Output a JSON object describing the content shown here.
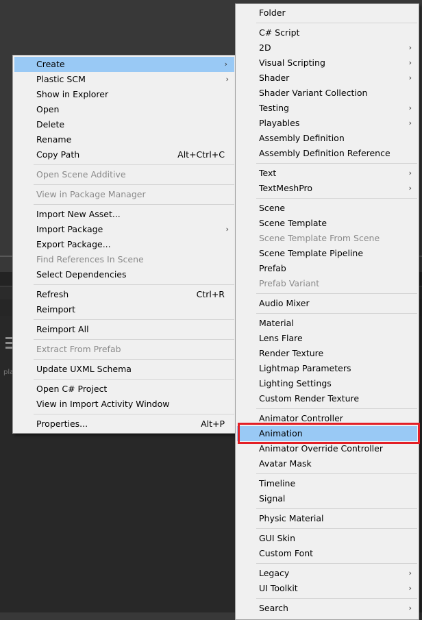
{
  "background": {
    "label": "pla"
  },
  "left_menu": {
    "groups": [
      [
        {
          "label": "Create",
          "submenu": true,
          "highlight": true
        },
        {
          "label": "Plastic SCM",
          "submenu": true
        },
        {
          "label": "Show in Explorer"
        },
        {
          "label": "Open"
        },
        {
          "label": "Delete"
        },
        {
          "label": "Rename"
        },
        {
          "label": "Copy Path",
          "shortcut": "Alt+Ctrl+C"
        }
      ],
      [
        {
          "label": "Open Scene Additive",
          "disabled": true
        }
      ],
      [
        {
          "label": "View in Package Manager",
          "disabled": true
        }
      ],
      [
        {
          "label": "Import New Asset..."
        },
        {
          "label": "Import Package",
          "submenu": true
        },
        {
          "label": "Export Package..."
        },
        {
          "label": "Find References In Scene",
          "disabled": true
        },
        {
          "label": "Select Dependencies"
        }
      ],
      [
        {
          "label": "Refresh",
          "shortcut": "Ctrl+R"
        },
        {
          "label": "Reimport"
        }
      ],
      [
        {
          "label": "Reimport All"
        }
      ],
      [
        {
          "label": "Extract From Prefab",
          "disabled": true
        }
      ],
      [
        {
          "label": "Update UXML Schema"
        }
      ],
      [
        {
          "label": "Open C# Project"
        },
        {
          "label": "View in Import Activity Window"
        }
      ],
      [
        {
          "label": "Properties...",
          "shortcut": "Alt+P"
        }
      ]
    ]
  },
  "right_menu": {
    "groups": [
      [
        {
          "label": "Folder"
        }
      ],
      [
        {
          "label": "C# Script"
        },
        {
          "label": "2D",
          "submenu": true
        },
        {
          "label": "Visual Scripting",
          "submenu": true
        },
        {
          "label": "Shader",
          "submenu": true
        },
        {
          "label": "Shader Variant Collection"
        },
        {
          "label": "Testing",
          "submenu": true
        },
        {
          "label": "Playables",
          "submenu": true
        },
        {
          "label": "Assembly Definition"
        },
        {
          "label": "Assembly Definition Reference"
        }
      ],
      [
        {
          "label": "Text",
          "submenu": true
        },
        {
          "label": "TextMeshPro",
          "submenu": true
        }
      ],
      [
        {
          "label": "Scene"
        },
        {
          "label": "Scene Template"
        },
        {
          "label": "Scene Template From Scene",
          "disabled": true
        },
        {
          "label": "Scene Template Pipeline"
        },
        {
          "label": "Prefab"
        },
        {
          "label": "Prefab Variant",
          "disabled": true
        }
      ],
      [
        {
          "label": "Audio Mixer"
        }
      ],
      [
        {
          "label": "Material"
        },
        {
          "label": "Lens Flare"
        },
        {
          "label": "Render Texture"
        },
        {
          "label": "Lightmap Parameters"
        },
        {
          "label": "Lighting Settings"
        },
        {
          "label": "Custom Render Texture"
        }
      ],
      [
        {
          "label": "Animator Controller"
        },
        {
          "label": "Animation",
          "highlight": true
        },
        {
          "label": "Animator Override Controller"
        },
        {
          "label": "Avatar Mask"
        }
      ],
      [
        {
          "label": "Timeline"
        },
        {
          "label": "Signal"
        }
      ],
      [
        {
          "label": "Physic Material"
        }
      ],
      [
        {
          "label": "GUI Skin"
        },
        {
          "label": "Custom Font"
        }
      ],
      [
        {
          "label": "Legacy",
          "submenu": true
        },
        {
          "label": "UI Toolkit",
          "submenu": true
        }
      ],
      [
        {
          "label": "Search",
          "submenu": true
        }
      ]
    ]
  },
  "arrow_glyph": "›",
  "colors": {
    "menu_bg": "#f0f0f0",
    "highlight": "#99c9f5",
    "disabled_text": "#8a8a8a",
    "callout": "#e31e25"
  }
}
